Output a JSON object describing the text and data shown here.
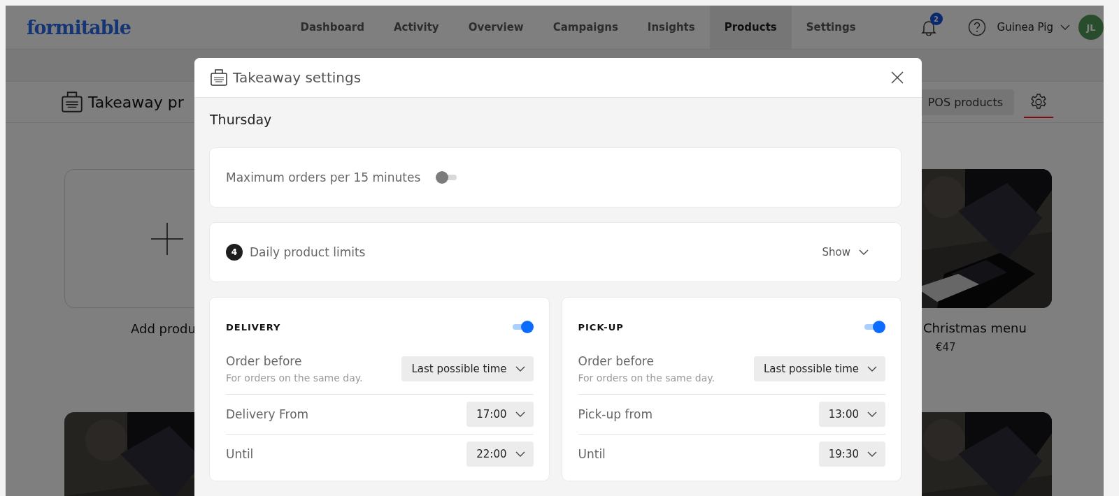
{
  "app": {
    "logo": "formitable",
    "nav": [
      {
        "label": "Dashboard",
        "selected": false
      },
      {
        "label": "Activity",
        "selected": false
      },
      {
        "label": "Overview",
        "selected": false
      },
      {
        "label": "Campaigns",
        "selected": false
      },
      {
        "label": "Insights",
        "selected": false
      },
      {
        "label": "Products",
        "selected": true
      },
      {
        "label": "Settings",
        "selected": false
      }
    ],
    "notification_count": "2",
    "user": {
      "name": "Guinea Pig",
      "initials": "JL"
    }
  },
  "page": {
    "title": "Takeaway pr",
    "pos_button": "POS products",
    "cards": [
      {
        "kind": "add",
        "label": "Add produ"
      },
      {
        "kind": "product",
        "name": "Christmas menu",
        "price": "€47"
      },
      {
        "kind": "picture"
      },
      {
        "kind": "picture"
      }
    ]
  },
  "modal": {
    "title": "Takeaway settings",
    "day": "Thursday",
    "max_orders": {
      "label": "Maximum orders per 15 minutes",
      "on": false
    },
    "limits": {
      "count": "4",
      "label": "Daily product limits",
      "toggle": "Show"
    },
    "channels": [
      {
        "title": "DELIVERY",
        "on": true,
        "rows": [
          {
            "label": "Order before",
            "hint": "For orders on the same day.",
            "value": "Last possible time"
          },
          {
            "label": "Delivery From",
            "value": "17:00"
          },
          {
            "label": "Until",
            "value": "22:00"
          }
        ]
      },
      {
        "title": "PICK-UP",
        "on": true,
        "rows": [
          {
            "label": "Order before",
            "hint": "For orders on the same day.",
            "value": "Last possible time"
          },
          {
            "label": "Pick-up from",
            "value": "13:00"
          },
          {
            "label": "Until",
            "value": "19:30"
          }
        ]
      }
    ]
  }
}
